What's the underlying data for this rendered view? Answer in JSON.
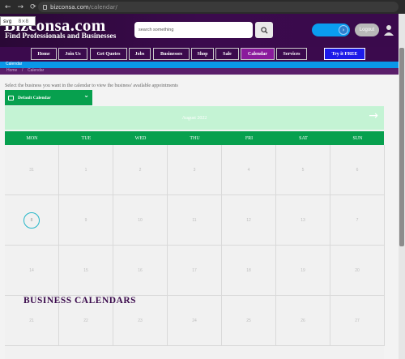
{
  "browser": {
    "url_host": "bizconsa.com",
    "url_path": "/calendar/",
    "back_icon": "arrow-left-icon",
    "forward_icon": "arrow-right-icon",
    "reload_icon": "reload-icon"
  },
  "tooltip": {
    "tag": "svg",
    "size": "8×8"
  },
  "header": {
    "logo": "Bizconsa.com",
    "tagline": "Find Professionals and Businesses",
    "search_placeholder": "search something",
    "logout_label": "Logout"
  },
  "nav": {
    "items": [
      {
        "label": "Home"
      },
      {
        "label": "Join Us"
      },
      {
        "label": "Get Quotes"
      },
      {
        "label": "Jobs"
      },
      {
        "label": "Businesses"
      },
      {
        "label": "Shop"
      },
      {
        "label": "Sale"
      },
      {
        "label": "Calendar",
        "active": true
      },
      {
        "label": "Services"
      }
    ],
    "cta_label": "Try it FREE"
  },
  "breadcrumb": {
    "section": "Calendar",
    "home": "Home",
    "separator": "/",
    "current": "Calendar"
  },
  "calendar": {
    "instruction": "Select the business you want in the calendar to view the business' available appointments",
    "selected_calendar": "Default Calendar",
    "month_label": "August 2022",
    "days": [
      "MON",
      "TUE",
      "WED",
      "THU",
      "FRI",
      "SAT",
      "SUN"
    ],
    "weeks": [
      [
        "31",
        "1",
        "2",
        "3",
        "4",
        "5",
        "6"
      ],
      [
        "8",
        "9",
        "10",
        "11",
        "12",
        "13",
        "7"
      ],
      [
        "14",
        "15",
        "16",
        "17",
        "18",
        "19",
        "20"
      ],
      [
        "21",
        "22",
        "23",
        "24",
        "25",
        "26",
        "27"
      ]
    ],
    "today": "8"
  },
  "section_title": "BUSINESS CALENDARS",
  "colors": {
    "header_purple": "#3b0a4d",
    "active_nav": "#8a1a9c",
    "cta_blue": "#1d1be8",
    "calendar_green": "#07a04e",
    "month_bar_mint": "#c4f3d4",
    "breadcrumb_blue": "#0a97e8"
  }
}
